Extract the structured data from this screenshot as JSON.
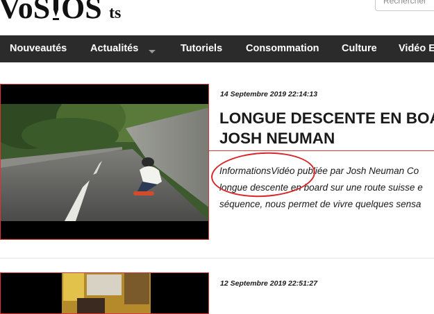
{
  "site": {
    "logo_text": "VoSIOSts"
  },
  "search": {
    "placeholder": "Rechercher"
  },
  "nav": {
    "items": [
      {
        "label": "Nouveautés"
      },
      {
        "label": "Actualités"
      },
      {
        "label": "Tutoriels"
      },
      {
        "label": "Consommation"
      },
      {
        "label": "Culture"
      },
      {
        "label": "Vidéo E"
      }
    ]
  },
  "articles": [
    {
      "date": "14 Septembre 2019 22:14:13",
      "title": "LONGUE DESCENTE EN BOA\nJOSH NEUMAN",
      "excerpt": "InformationsVidéo publiée par Josh Neuman Co\nlongue descente en board sur une route suisse e\nséquence, nous permet de vivre quelques sensa"
    },
    {
      "date": "12 Septembre 2019 22:51:27"
    }
  ],
  "colors": {
    "nav_bg": "#2b2b2b",
    "accent": "#d33333",
    "annotation": "#d8262b"
  }
}
